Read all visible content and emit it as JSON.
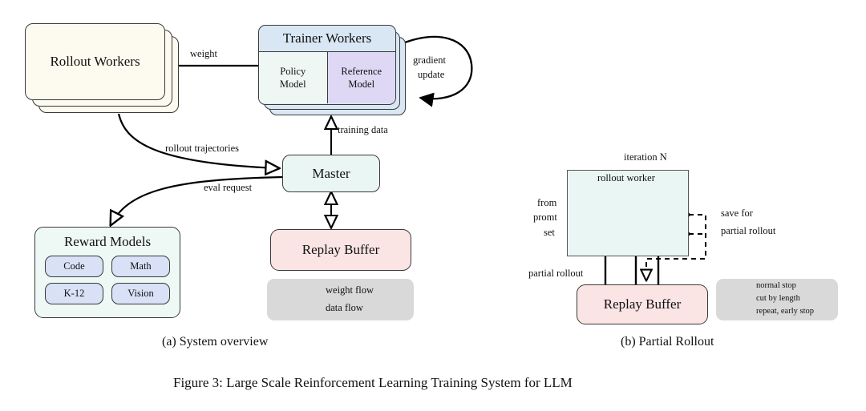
{
  "figure": {
    "caption": "Figure 3: Large Scale Reinforcement Learning Training System for LLM",
    "subcaption_a": "(a) System overview",
    "subcaption_b": "(b) Partial Rollout"
  },
  "panel_a": {
    "rollout_workers": {
      "label": "Rollout Workers",
      "color": "#fdfaef"
    },
    "trainer_workers": {
      "label": "Trainer Workers",
      "header_color": "#d8e7f3",
      "policy_model": {
        "label_line1": "Policy",
        "label_line2": "Model",
        "color": "#eef7f4"
      },
      "reference_model": {
        "label_line1": "Reference",
        "label_line2": "Model",
        "color": "#ded8f5"
      }
    },
    "master": {
      "label": "Master",
      "color": "#e9f6f3"
    },
    "replay_buffer": {
      "label": "Replay Buffer",
      "color": "#fbe4e4"
    },
    "reward_models": {
      "label": "Reward Models",
      "color": "#eef8f4",
      "items": [
        "Code",
        "Math",
        "K-12",
        "Vision"
      ],
      "item_color": "#d9e1f7"
    },
    "edge_labels": {
      "weight": "weight",
      "gradient_update_line1": "gradient",
      "gradient_update_line2": "update",
      "training_data": "training data",
      "rollout_trajectories": "rollout trajectories",
      "eval_request": "eval request"
    },
    "legend": {
      "background": "#d9d9d9",
      "items": [
        {
          "label": "weight flow",
          "arrow": "solid-filled-arrow"
        },
        {
          "label": "data flow",
          "arrow": "solid-hollow-arrow"
        }
      ]
    }
  },
  "panel_b": {
    "iteration_label": "iteration N",
    "rollout_worker": {
      "label": "rollout worker",
      "color": "#e9f6f3"
    },
    "replay_buffer": {
      "label": "Replay Buffer",
      "color": "#fbe4e4"
    },
    "side_labels": {
      "from": "from",
      "promt": "promt",
      "set": "set",
      "partial_rollout": "partial rollout",
      "save_for_line1": "save for",
      "save_for_line2": "partial rollout"
    },
    "legend": {
      "background": "#d9d9d9",
      "items": [
        {
          "marker": "filled-circle",
          "label": "normal stop"
        },
        {
          "marker": "hollow-diamond",
          "label": "cut by length"
        },
        {
          "marker": "cross",
          "label": "repeat, early stop"
        }
      ]
    }
  }
}
